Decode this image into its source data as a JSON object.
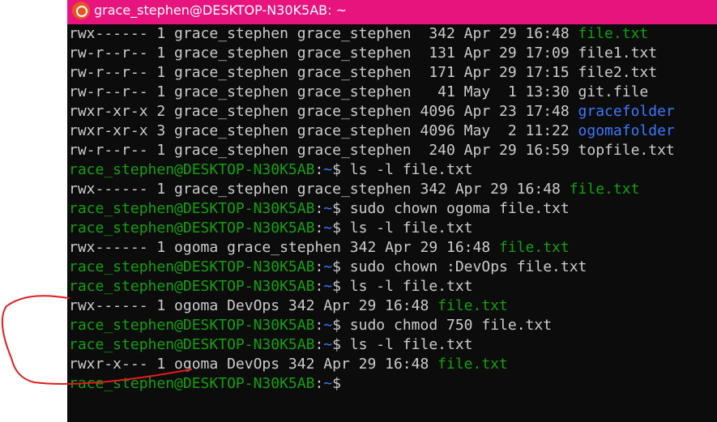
{
  "window": {
    "title": "grace_stephen@DESKTOP-N30K5AB: ~",
    "icon": "ubuntu-icon",
    "title_bar_color": "#e8147e"
  },
  "terminal": {
    "background": "#0c0c0c",
    "colors": {
      "text": "#cccccc",
      "green": "#13a10e",
      "blue": "#3b78ff"
    },
    "lines": [
      {
        "segments": [
          {
            "text": "rwx------ 1 grace_stephen grace_stephen  342 Apr 29 16:48 ",
            "color": "text"
          },
          {
            "text": "file.txt",
            "color": "green"
          }
        ]
      },
      {
        "segments": [
          {
            "text": "rw-r--r-- 1 grace_stephen grace_stephen  131 Apr 29 17:09 file1.txt",
            "color": "text"
          }
        ]
      },
      {
        "segments": [
          {
            "text": "rw-r--r-- 1 grace_stephen grace_stephen  171 Apr 29 17:15 file2.txt",
            "color": "text"
          }
        ]
      },
      {
        "segments": [
          {
            "text": "rw-r--r-- 1 grace_stephen grace_stephen   41 May  1 13:30 git.file",
            "color": "text"
          }
        ]
      },
      {
        "segments": [
          {
            "text": "rwxr-xr-x 2 grace_stephen grace_stephen 4096 Apr 23 17:48 ",
            "color": "text"
          },
          {
            "text": "gracefolder",
            "color": "blue"
          }
        ]
      },
      {
        "segments": [
          {
            "text": "rwxr-xr-x 3 grace_stephen grace_stephen 4096 May  2 11:22 ",
            "color": "text"
          },
          {
            "text": "ogomafolder",
            "color": "blue"
          }
        ]
      },
      {
        "segments": [
          {
            "text": "rw-r--r-- 1 grace_stephen grace_stephen  240 Apr 29 16:59 topfile.txt",
            "color": "text"
          }
        ]
      },
      {
        "segments": [
          {
            "text": "race_stephen@DESKTOP-N30K5AB",
            "color": "green"
          },
          {
            "text": ":",
            "color": "text"
          },
          {
            "text": "~",
            "color": "blue"
          },
          {
            "text": "$ ls -l file.txt",
            "color": "text"
          }
        ]
      },
      {
        "segments": [
          {
            "text": "rwx------ 1 grace_stephen grace_stephen 342 Apr 29 16:48 ",
            "color": "text"
          },
          {
            "text": "file.txt",
            "color": "green"
          }
        ]
      },
      {
        "segments": [
          {
            "text": "race_stephen@DESKTOP-N30K5AB",
            "color": "green"
          },
          {
            "text": ":",
            "color": "text"
          },
          {
            "text": "~",
            "color": "blue"
          },
          {
            "text": "$ sudo chown ogoma file.txt",
            "color": "text"
          }
        ]
      },
      {
        "segments": [
          {
            "text": "race_stephen@DESKTOP-N30K5AB",
            "color": "green"
          },
          {
            "text": ":",
            "color": "text"
          },
          {
            "text": "~",
            "color": "blue"
          },
          {
            "text": "$ ls -l file.txt",
            "color": "text"
          }
        ]
      },
      {
        "segments": [
          {
            "text": "rwx------ 1 ogoma grace_stephen 342 Apr 29 16:48 ",
            "color": "text"
          },
          {
            "text": "file.txt",
            "color": "green"
          }
        ]
      },
      {
        "segments": [
          {
            "text": "race_stephen@DESKTOP-N30K5AB",
            "color": "green"
          },
          {
            "text": ":",
            "color": "text"
          },
          {
            "text": "~",
            "color": "blue"
          },
          {
            "text": "$ sudo chown :DevOps file.txt",
            "color": "text"
          }
        ]
      },
      {
        "segments": [
          {
            "text": "race_stephen@DESKTOP-N30K5AB",
            "color": "green"
          },
          {
            "text": ":",
            "color": "text"
          },
          {
            "text": "~",
            "color": "blue"
          },
          {
            "text": "$ ls -l file.txt",
            "color": "text"
          }
        ]
      },
      {
        "segments": [
          {
            "text": "rwx------ 1 ogoma DevOps 342 Apr 29 16:48 ",
            "color": "text"
          },
          {
            "text": "file.txt",
            "color": "green"
          }
        ]
      },
      {
        "segments": [
          {
            "text": "race_stephen@DESKTOP-N30K5AB",
            "color": "green"
          },
          {
            "text": ":",
            "color": "text"
          },
          {
            "text": "~",
            "color": "blue"
          },
          {
            "text": "$ sudo chmod 750 file.txt",
            "color": "text"
          }
        ]
      },
      {
        "segments": [
          {
            "text": "race_stephen@DESKTOP-N30K5AB",
            "color": "green"
          },
          {
            "text": ":",
            "color": "text"
          },
          {
            "text": "~",
            "color": "blue"
          },
          {
            "text": "$ ls -l file.txt",
            "color": "text"
          }
        ]
      },
      {
        "segments": [
          {
            "text": "rwxr-x--- 1 ogoma DevOps 342 Apr 29 16:48 ",
            "color": "text"
          },
          {
            "text": "file.txt",
            "color": "green"
          }
        ]
      },
      {
        "segments": [
          {
            "text": "race_stephen@DESKTOP-N30K5AB",
            "color": "green"
          },
          {
            "text": ":",
            "color": "text"
          },
          {
            "text": "~",
            "color": "blue"
          },
          {
            "text": "$ ",
            "color": "text"
          }
        ]
      }
    ]
  },
  "annotation": {
    "color": "#e31b1b"
  }
}
